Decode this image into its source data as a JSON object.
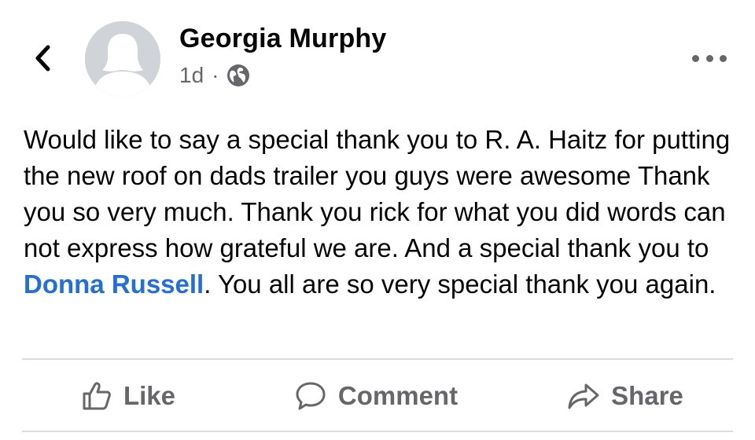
{
  "post": {
    "author": "Georgia Murphy",
    "time": "1d",
    "separator": "·",
    "privacy_icon": "globe-icon",
    "text_parts": {
      "before_mention": "Would like to say a special thank you to R. A. Haitz for putting the new roof on dads trailer you guys were awesome Thank you so very much. Thank you rick for what you did words can not express how grateful we are. And a special thank you to ",
      "mention": "Donna Russell",
      "after_mention": ". You all are so very special thank you again."
    }
  },
  "actions": {
    "like_label": "Like",
    "comment_label": "Comment",
    "share_label": "Share"
  },
  "colors": {
    "mention": "#216fdb",
    "secondary_text": "#65676b",
    "avatar_bg": "#d0d3d8",
    "divider": "#dadde1"
  }
}
